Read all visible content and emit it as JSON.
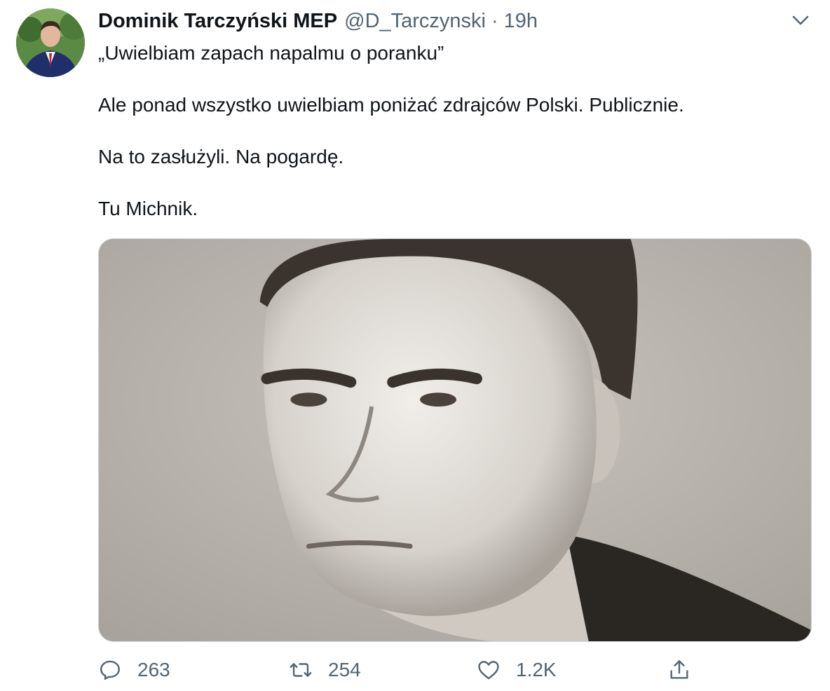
{
  "tweet": {
    "author": {
      "display_name": "Dominik Tarczyński MEP",
      "handle": "@D_Tarczynski",
      "separator": "·",
      "time": "19h"
    },
    "text_lines": [
      "„Uwielbiam zapach napalmu o poranku”",
      "Ale ponad wszystko uwielbiam poniżać zdrajców Polski. Publicznie.",
      "Na to zasłużyli. Na pogardę.",
      "Tu Michnik."
    ],
    "actions": {
      "reply": {
        "icon": "speech-bubble-icon",
        "count": "263"
      },
      "retweet": {
        "icon": "retweet-arrows-icon",
        "count": "254"
      },
      "like": {
        "icon": "heart-icon",
        "count": "1.2K"
      },
      "share": {
        "icon": "share-upload-icon"
      }
    },
    "icons": {
      "more": "chevron-down-icon"
    }
  },
  "colors": {
    "text_primary": "#0f1419",
    "text_secondary": "#536471",
    "media_border": "#cfd9de"
  }
}
